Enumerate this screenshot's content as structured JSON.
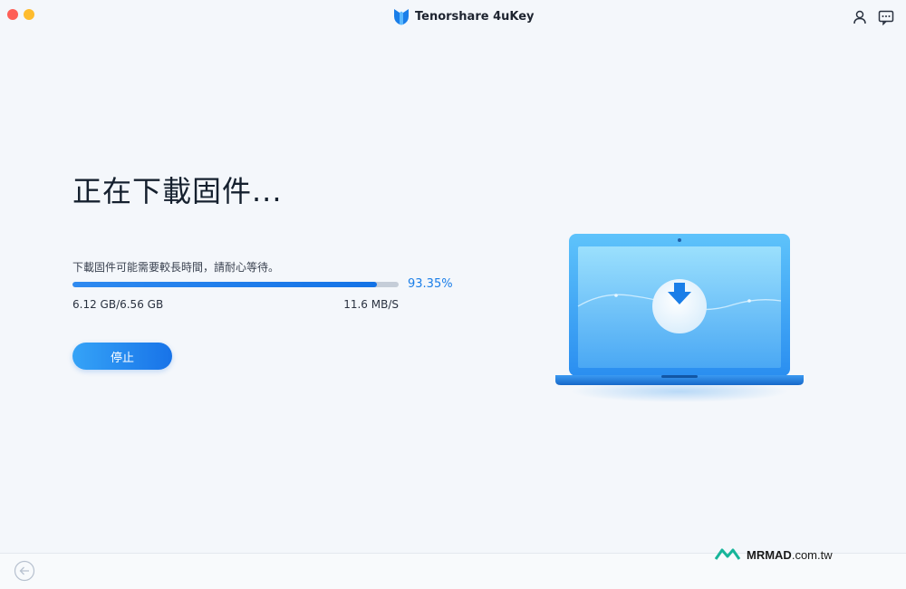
{
  "window": {
    "app_name": "Tenorshare 4uKey",
    "colors": {
      "accent": "#1a7ee8",
      "background": "#f4f7fb"
    }
  },
  "titlebar": {
    "icons": [
      "user-icon",
      "feedback-icon"
    ]
  },
  "main": {
    "heading": "正在下載固件...",
    "hint": "下載固件可能需要較長時間，請耐心等待。",
    "progress_fraction": 0.9335,
    "percent_label": "93.35%",
    "size_label": "6.12 GB/6.56 GB",
    "speed_label": "11.6 MB/S",
    "stop_label": "停止"
  },
  "illustration": {
    "icon": "laptop-download-icon"
  },
  "footer": {
    "back_icon": "back-arrow-icon",
    "watermark_brand": "MRMAD",
    "watermark_domain": ".com.tw"
  }
}
